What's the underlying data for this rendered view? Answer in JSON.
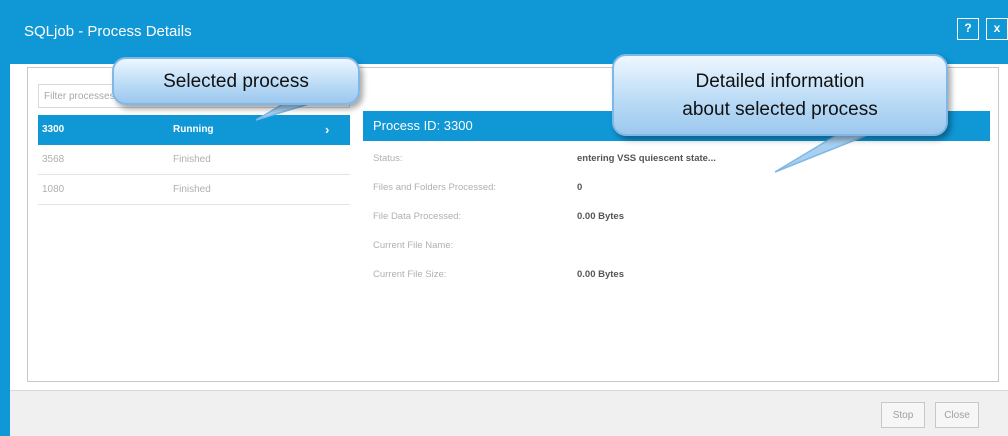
{
  "window": {
    "title": "SQLjob - Process Details",
    "help_label": "?",
    "close_label": "x",
    "accent_color": "#0f97d6"
  },
  "filter": {
    "placeholder": "Filter processes"
  },
  "processes": [
    {
      "id": "3300",
      "status": "Running",
      "selected": true
    },
    {
      "id": "3568",
      "status": "Finished",
      "selected": false
    },
    {
      "id": "1080",
      "status": "Finished",
      "selected": false
    }
  ],
  "icons": {
    "chevron": "chevron-right-icon"
  },
  "details": {
    "header": "Process ID: 3300",
    "rows": [
      {
        "label": "Status:",
        "value": "entering VSS quiescent state..."
      },
      {
        "label": "Files and Folders Processed:",
        "value": "0"
      },
      {
        "label": "File Data Processed:",
        "value": "0.00 Bytes"
      },
      {
        "label": "Current File Name:",
        "value": ""
      },
      {
        "label": "Current File Size:",
        "value": "0.00 Bytes"
      }
    ]
  },
  "footer": {
    "stop_label": "Stop",
    "close_label": "Close"
  },
  "callouts": {
    "selected": "Selected process",
    "detail_line1": "Detailed information",
    "detail_line2": "about selected process"
  }
}
